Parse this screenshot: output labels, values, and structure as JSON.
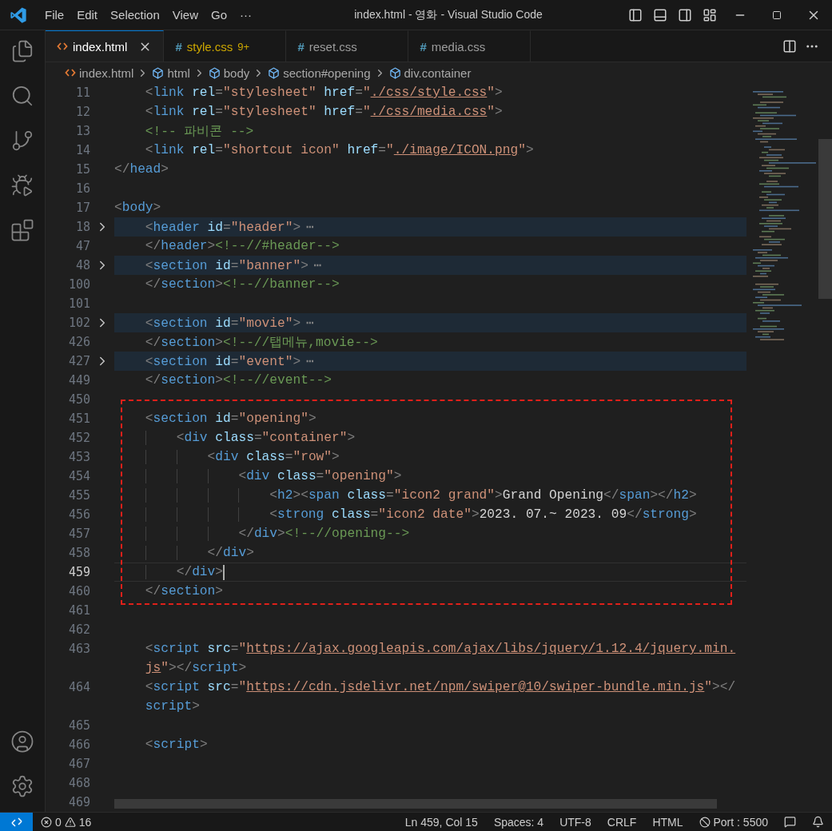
{
  "title_bar": {
    "menu": [
      "File",
      "Edit",
      "Selection",
      "View",
      "Go"
    ],
    "more": "···",
    "title": "index.html - 영화 - Visual Studio Code"
  },
  "activity_bar": {
    "top": [
      {
        "kind": "explorer"
      },
      {
        "kind": "search"
      },
      {
        "kind": "source-control"
      },
      {
        "kind": "run-debug"
      },
      {
        "kind": "extensions"
      }
    ],
    "bottom": [
      {
        "kind": "account"
      },
      {
        "kind": "settings"
      }
    ]
  },
  "tabs": [
    {
      "kind": "html",
      "label": "index.html",
      "selected": true,
      "warning": false
    },
    {
      "kind": "css",
      "icon": "#",
      "label": "style.css",
      "badge": "9+",
      "selected": false,
      "warning": true
    },
    {
      "kind": "css",
      "icon": "#",
      "label": "reset.css",
      "selected": false,
      "warning": false
    },
    {
      "kind": "css",
      "icon": "#",
      "label": "media.css",
      "selected": false,
      "warning": false
    }
  ],
  "breadcrumb": [
    {
      "kind": "file",
      "label": "index.html"
    },
    {
      "kind": "element",
      "label": "html"
    },
    {
      "kind": "element",
      "label": "body"
    },
    {
      "kind": "element",
      "label": "section#opening"
    },
    {
      "kind": "element",
      "label": "div.container"
    }
  ],
  "lines": [
    {
      "number": "11",
      "folded": false,
      "current": false,
      "rows": [
        [
          {
            "kind": "text",
            "text": "    "
          },
          {
            "kind": "punct",
            "text": "<"
          },
          {
            "kind": "tag",
            "text": "link"
          },
          {
            "kind": "text",
            "text": " "
          },
          {
            "kind": "attr",
            "text": "rel"
          },
          {
            "kind": "punct",
            "text": "="
          },
          {
            "kind": "string",
            "text": "\"stylesheet\""
          },
          {
            "kind": "text",
            "text": " "
          },
          {
            "kind": "attr",
            "text": "href"
          },
          {
            "kind": "punct",
            "text": "="
          },
          {
            "kind": "string",
            "text": "\""
          },
          {
            "kind": "url",
            "text": "./css/style.css"
          },
          {
            "kind": "string",
            "text": "\""
          },
          {
            "kind": "punct",
            "text": ">"
          }
        ]
      ]
    },
    {
      "number": "12",
      "folded": false,
      "current": false,
      "rows": [
        [
          {
            "kind": "text",
            "text": "    "
          },
          {
            "kind": "punct",
            "text": "<"
          },
          {
            "kind": "tag",
            "text": "link"
          },
          {
            "kind": "text",
            "text": " "
          },
          {
            "kind": "attr",
            "text": "rel"
          },
          {
            "kind": "punct",
            "text": "="
          },
          {
            "kind": "string",
            "text": "\"stylesheet\""
          },
          {
            "kind": "text",
            "text": " "
          },
          {
            "kind": "attr",
            "text": "href"
          },
          {
            "kind": "punct",
            "text": "="
          },
          {
            "kind": "string",
            "text": "\""
          },
          {
            "kind": "url",
            "text": "./css/media.css"
          },
          {
            "kind": "string",
            "text": "\""
          },
          {
            "kind": "punct",
            "text": ">"
          }
        ]
      ]
    },
    {
      "number": "13",
      "folded": false,
      "current": false,
      "rows": [
        [
          {
            "kind": "text",
            "text": "    "
          },
          {
            "kind": "comment",
            "text": "<!-- 파비콘 -->"
          }
        ]
      ]
    },
    {
      "number": "14",
      "folded": false,
      "current": false,
      "rows": [
        [
          {
            "kind": "text",
            "text": "    "
          },
          {
            "kind": "punct",
            "text": "<"
          },
          {
            "kind": "tag",
            "text": "link"
          },
          {
            "kind": "text",
            "text": " "
          },
          {
            "kind": "attr",
            "text": "rel"
          },
          {
            "kind": "punct",
            "text": "="
          },
          {
            "kind": "string",
            "text": "\"shortcut icon\""
          },
          {
            "kind": "text",
            "text": " "
          },
          {
            "kind": "attr",
            "text": "href"
          },
          {
            "kind": "punct",
            "text": "="
          },
          {
            "kind": "string",
            "text": "\""
          },
          {
            "kind": "url",
            "text": "./image/ICON.png"
          },
          {
            "kind": "string",
            "text": "\""
          },
          {
            "kind": "punct",
            "text": ">"
          }
        ]
      ]
    },
    {
      "number": "15",
      "folded": false,
      "current": false,
      "rows": [
        [
          {
            "kind": "punct",
            "text": "</"
          },
          {
            "kind": "tag",
            "text": "head"
          },
          {
            "kind": "punct",
            "text": ">"
          }
        ]
      ]
    },
    {
      "number": "16",
      "folded": false,
      "current": false,
      "rows": [
        []
      ]
    },
    {
      "number": "17",
      "folded": false,
      "current": false,
      "rows": [
        [
          {
            "kind": "punct",
            "text": "<"
          },
          {
            "kind": "tag",
            "text": "body"
          },
          {
            "kind": "punct",
            "text": ">"
          }
        ]
      ]
    },
    {
      "number": "18",
      "folded": true,
      "current": false,
      "rows": [
        [
          {
            "kind": "text",
            "text": "    "
          },
          {
            "kind": "punct",
            "text": "<"
          },
          {
            "kind": "tag",
            "text": "header"
          },
          {
            "kind": "text",
            "text": " "
          },
          {
            "kind": "attr",
            "text": "id"
          },
          {
            "kind": "punct",
            "text": "="
          },
          {
            "kind": "string",
            "text": "\"header\""
          },
          {
            "kind": "punct",
            "text": ">"
          },
          {
            "kind": "fold",
            "text": "⋯"
          }
        ]
      ]
    },
    {
      "number": "47",
      "folded": false,
      "current": false,
      "rows": [
        [
          {
            "kind": "text",
            "text": "    "
          },
          {
            "kind": "punct",
            "text": "</"
          },
          {
            "kind": "tag",
            "text": "header"
          },
          {
            "kind": "punct",
            "text": ">"
          },
          {
            "kind": "comment",
            "text": "<!--//#header-->"
          }
        ]
      ]
    },
    {
      "number": "48",
      "folded": true,
      "current": false,
      "rows": [
        [
          {
            "kind": "text",
            "text": "    "
          },
          {
            "kind": "punct",
            "text": "<"
          },
          {
            "kind": "tag",
            "text": "section"
          },
          {
            "kind": "text",
            "text": " "
          },
          {
            "kind": "attr",
            "text": "id"
          },
          {
            "kind": "punct",
            "text": "="
          },
          {
            "kind": "string",
            "text": "\"banner\""
          },
          {
            "kind": "punct",
            "text": ">"
          },
          {
            "kind": "fold",
            "text": "⋯"
          }
        ]
      ]
    },
    {
      "number": "100",
      "folded": false,
      "current": false,
      "rows": [
        [
          {
            "kind": "text",
            "text": "    "
          },
          {
            "kind": "punct",
            "text": "</"
          },
          {
            "kind": "tag",
            "text": "section"
          },
          {
            "kind": "punct",
            "text": ">"
          },
          {
            "kind": "comment",
            "text": "<!--//banner-->"
          }
        ]
      ]
    },
    {
      "number": "101",
      "folded": false,
      "current": false,
      "rows": [
        []
      ]
    },
    {
      "number": "102",
      "folded": true,
      "current": false,
      "rows": [
        [
          {
            "kind": "text",
            "text": "    "
          },
          {
            "kind": "punct",
            "text": "<"
          },
          {
            "kind": "tag",
            "text": "section"
          },
          {
            "kind": "text",
            "text": " "
          },
          {
            "kind": "attr",
            "text": "id"
          },
          {
            "kind": "punct",
            "text": "="
          },
          {
            "kind": "string",
            "text": "\"movie\""
          },
          {
            "kind": "punct",
            "text": ">"
          },
          {
            "kind": "fold",
            "text": "⋯"
          }
        ]
      ]
    },
    {
      "number": "426",
      "folded": false,
      "current": false,
      "rows": [
        [
          {
            "kind": "text",
            "text": "    "
          },
          {
            "kind": "punct",
            "text": "</"
          },
          {
            "kind": "tag",
            "text": "section"
          },
          {
            "kind": "punct",
            "text": ">"
          },
          {
            "kind": "comment",
            "text": "<!--//탭메뉴,movie-->"
          }
        ]
      ]
    },
    {
      "number": "427",
      "folded": true,
      "current": false,
      "rows": [
        [
          {
            "kind": "text",
            "text": "    "
          },
          {
            "kind": "punct",
            "text": "<"
          },
          {
            "kind": "tag",
            "text": "section"
          },
          {
            "kind": "text",
            "text": " "
          },
          {
            "kind": "attr",
            "text": "id"
          },
          {
            "kind": "punct",
            "text": "="
          },
          {
            "kind": "string",
            "text": "\"event\""
          },
          {
            "kind": "punct",
            "text": ">"
          },
          {
            "kind": "fold",
            "text": "⋯"
          }
        ]
      ]
    },
    {
      "number": "449",
      "folded": false,
      "current": false,
      "rows": [
        [
          {
            "kind": "text",
            "text": "    "
          },
          {
            "kind": "punct",
            "text": "</"
          },
          {
            "kind": "tag",
            "text": "section"
          },
          {
            "kind": "punct",
            "text": ">"
          },
          {
            "kind": "comment",
            "text": "<!--//event-->"
          }
        ]
      ]
    },
    {
      "number": "450",
      "folded": false,
      "current": false,
      "rows": [
        []
      ]
    },
    {
      "number": "451",
      "folded": false,
      "current": false,
      "rows": [
        [
          {
            "kind": "text",
            "text": "    "
          },
          {
            "kind": "punct",
            "text": "<"
          },
          {
            "kind": "tag",
            "text": "section"
          },
          {
            "kind": "text",
            "text": " "
          },
          {
            "kind": "attr",
            "text": "id"
          },
          {
            "kind": "punct",
            "text": "="
          },
          {
            "kind": "string",
            "text": "\"opening\""
          },
          {
            "kind": "punct",
            "text": ">"
          }
        ]
      ]
    },
    {
      "number": "452",
      "folded": false,
      "current": false,
      "rows": [
        [
          {
            "kind": "text",
            "text": "        "
          },
          {
            "kind": "punct",
            "text": "<"
          },
          {
            "kind": "tag",
            "text": "div"
          },
          {
            "kind": "text",
            "text": " "
          },
          {
            "kind": "attr",
            "text": "class"
          },
          {
            "kind": "punct",
            "text": "="
          },
          {
            "kind": "string",
            "text": "\"container\""
          },
          {
            "kind": "punct",
            "text": ">"
          }
        ]
      ]
    },
    {
      "number": "453",
      "folded": false,
      "current": false,
      "rows": [
        [
          {
            "kind": "text",
            "text": "            "
          },
          {
            "kind": "punct",
            "text": "<"
          },
          {
            "kind": "tag",
            "text": "div"
          },
          {
            "kind": "text",
            "text": " "
          },
          {
            "kind": "attr",
            "text": "class"
          },
          {
            "kind": "punct",
            "text": "="
          },
          {
            "kind": "string",
            "text": "\"row\""
          },
          {
            "kind": "punct",
            "text": ">"
          }
        ]
      ]
    },
    {
      "number": "454",
      "folded": false,
      "current": false,
      "rows": [
        [
          {
            "kind": "text",
            "text": "                "
          },
          {
            "kind": "punct",
            "text": "<"
          },
          {
            "kind": "tag",
            "text": "div"
          },
          {
            "kind": "text",
            "text": " "
          },
          {
            "kind": "attr",
            "text": "class"
          },
          {
            "kind": "punct",
            "text": "="
          },
          {
            "kind": "string",
            "text": "\"opening\""
          },
          {
            "kind": "punct",
            "text": ">"
          }
        ]
      ]
    },
    {
      "number": "455",
      "folded": false,
      "current": false,
      "rows": [
        [
          {
            "kind": "text",
            "text": "                    "
          },
          {
            "kind": "punct",
            "text": "<"
          },
          {
            "kind": "tag",
            "text": "h2"
          },
          {
            "kind": "punct",
            "text": "><"
          },
          {
            "kind": "tag",
            "text": "span"
          },
          {
            "kind": "text",
            "text": " "
          },
          {
            "kind": "attr",
            "text": "class"
          },
          {
            "kind": "punct",
            "text": "="
          },
          {
            "kind": "string",
            "text": "\"icon2 grand\""
          },
          {
            "kind": "punct",
            "text": ">"
          },
          {
            "kind": "text",
            "text": "Grand Opening"
          },
          {
            "kind": "punct",
            "text": "</"
          },
          {
            "kind": "tag",
            "text": "span"
          },
          {
            "kind": "punct",
            "text": "></"
          },
          {
            "kind": "tag",
            "text": "h2"
          },
          {
            "kind": "punct",
            "text": ">"
          }
        ]
      ]
    },
    {
      "number": "456",
      "folded": false,
      "current": false,
      "rows": [
        [
          {
            "kind": "text",
            "text": "                    "
          },
          {
            "kind": "punct",
            "text": "<"
          },
          {
            "kind": "tag",
            "text": "strong"
          },
          {
            "kind": "text",
            "text": " "
          },
          {
            "kind": "attr",
            "text": "class"
          },
          {
            "kind": "punct",
            "text": "="
          },
          {
            "kind": "string",
            "text": "\"icon2 date\""
          },
          {
            "kind": "punct",
            "text": ">"
          },
          {
            "kind": "text",
            "text": "2023. 07.~ 2023. 09"
          },
          {
            "kind": "punct",
            "text": "</"
          },
          {
            "kind": "tag",
            "text": "strong"
          },
          {
            "kind": "punct",
            "text": ">"
          }
        ]
      ]
    },
    {
      "number": "457",
      "folded": false,
      "current": false,
      "rows": [
        [
          {
            "kind": "text",
            "text": "                "
          },
          {
            "kind": "punct",
            "text": "</"
          },
          {
            "kind": "tag",
            "text": "div"
          },
          {
            "kind": "punct",
            "text": ">"
          },
          {
            "kind": "comment",
            "text": "<!--//opening-->"
          }
        ]
      ]
    },
    {
      "number": "458",
      "folded": false,
      "current": false,
      "rows": [
        [
          {
            "kind": "text",
            "text": "            "
          },
          {
            "kind": "punct",
            "text": "</"
          },
          {
            "kind": "tag",
            "text": "div"
          },
          {
            "kind": "punct",
            "text": ">"
          }
        ]
      ]
    },
    {
      "number": "459",
      "folded": false,
      "current": true,
      "rows": [
        [
          {
            "kind": "text",
            "text": "        "
          },
          {
            "kind": "punct",
            "text": "</"
          },
          {
            "kind": "tag",
            "text": "div"
          },
          {
            "kind": "punct",
            "text": ">"
          }
        ]
      ]
    },
    {
      "number": "460",
      "folded": false,
      "current": false,
      "rows": [
        [
          {
            "kind": "text",
            "text": "    "
          },
          {
            "kind": "punct",
            "text": "</"
          },
          {
            "kind": "tag",
            "text": "section"
          },
          {
            "kind": "punct",
            "text": ">"
          }
        ]
      ]
    },
    {
      "number": "461",
      "folded": false,
      "current": false,
      "rows": [
        []
      ]
    },
    {
      "number": "462",
      "folded": false,
      "current": false,
      "rows": [
        []
      ]
    },
    {
      "number": "463",
      "folded": false,
      "current": false,
      "rows": [
        [
          {
            "kind": "text",
            "text": "    "
          },
          {
            "kind": "punct",
            "text": "<"
          },
          {
            "kind": "tag",
            "text": "script"
          },
          {
            "kind": "text",
            "text": " "
          },
          {
            "kind": "attr",
            "text": "src"
          },
          {
            "kind": "punct",
            "text": "="
          },
          {
            "kind": "string",
            "text": "\""
          },
          {
            "kind": "url",
            "text": "https://ajax.googleapis.com/ajax/libs/jquery/1.12.4/jquery.min."
          },
          {
            "kind": "wrap"
          },
          {
            "kind": "text",
            "text": "    "
          },
          {
            "kind": "url",
            "text": "js"
          },
          {
            "kind": "string",
            "text": "\""
          },
          {
            "kind": "punct",
            "text": "></"
          },
          {
            "kind": "tag",
            "text": "script"
          },
          {
            "kind": "punct",
            "text": ">"
          }
        ]
      ]
    },
    {
      "number": "464",
      "folded": false,
      "current": false,
      "rows": [
        [
          {
            "kind": "text",
            "text": "    "
          },
          {
            "kind": "punct",
            "text": "<"
          },
          {
            "kind": "tag",
            "text": "script"
          },
          {
            "kind": "text",
            "text": " "
          },
          {
            "kind": "attr",
            "text": "src"
          },
          {
            "kind": "punct",
            "text": "="
          },
          {
            "kind": "string",
            "text": "\""
          },
          {
            "kind": "url",
            "text": "https://cdn.jsdelivr.net/npm/swiper@10/swiper-bundle.min.js"
          },
          {
            "kind": "string",
            "text": "\""
          },
          {
            "kind": "punct",
            "text": "></"
          },
          {
            "kind": "wrap"
          },
          {
            "kind": "text",
            "text": "    "
          },
          {
            "kind": "tag",
            "text": "script"
          },
          {
            "kind": "punct",
            "text": ">"
          }
        ]
      ]
    },
    {
      "number": "465",
      "folded": false,
      "current": false,
      "rows": [
        []
      ]
    },
    {
      "number": "466",
      "folded": false,
      "current": false,
      "rows": [
        [
          {
            "kind": "text",
            "text": "    "
          },
          {
            "kind": "punct",
            "text": "<"
          },
          {
            "kind": "tag",
            "text": "script"
          },
          {
            "kind": "punct",
            "text": ">"
          }
        ]
      ]
    },
    {
      "number": "467",
      "folded": false,
      "current": false,
      "rows": [
        []
      ]
    },
    {
      "number": "468",
      "folded": false,
      "current": false,
      "rows": [
        []
      ]
    },
    {
      "number": "469",
      "folded": false,
      "current": false,
      "rows": [
        []
      ]
    }
  ],
  "annotations": [
    {
      "kind": "dashed-rectangle"
    }
  ],
  "status_bar": {
    "errors": "0",
    "warnings": "16",
    "items": [
      "Ln 459, Col 15",
      "Spaces: 4",
      "UTF-8",
      "CRLF",
      "HTML"
    ],
    "port": "Port : 5500"
  }
}
